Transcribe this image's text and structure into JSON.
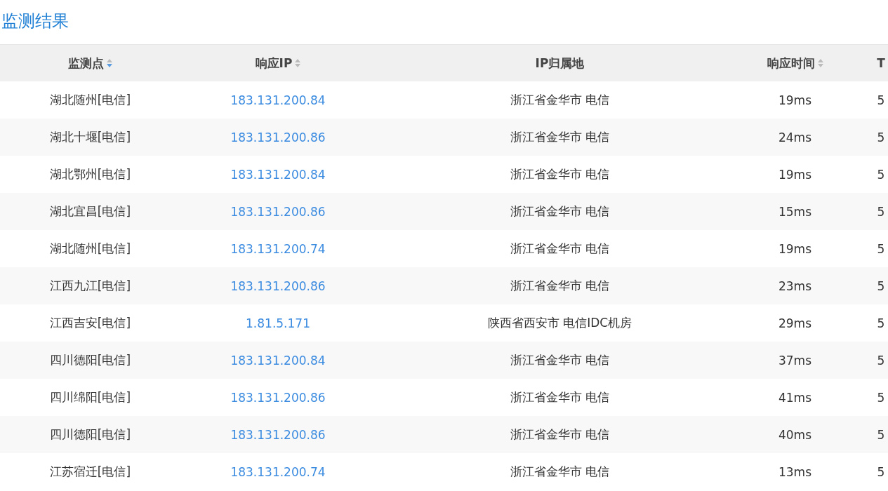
{
  "title": "监测结果",
  "table": {
    "columns": [
      {
        "kind": "sortable",
        "label": "监测点",
        "sorted": true
      },
      {
        "kind": "sortable",
        "label": "响应IP",
        "sorted": false
      },
      {
        "kind": "plain",
        "label": "IP归属地"
      },
      {
        "kind": "sortable",
        "label": "响应时间",
        "sorted": false
      },
      {
        "kind": "plain",
        "label": "T"
      }
    ],
    "rows": [
      [
        "湖北随州[电信]",
        "183.131.200.84",
        "浙江省金华市 电信",
        "19ms",
        "5"
      ],
      [
        "湖北十堰[电信]",
        "183.131.200.86",
        "浙江省金华市 电信",
        "24ms",
        "5"
      ],
      [
        "湖北鄂州[电信]",
        "183.131.200.84",
        "浙江省金华市 电信",
        "19ms",
        "5"
      ],
      [
        "湖北宜昌[电信]",
        "183.131.200.86",
        "浙江省金华市 电信",
        "15ms",
        "5"
      ],
      [
        "湖北随州[电信]",
        "183.131.200.74",
        "浙江省金华市 电信",
        "19ms",
        "5"
      ],
      [
        "江西九江[电信]",
        "183.131.200.86",
        "浙江省金华市 电信",
        "23ms",
        "5"
      ],
      [
        "江西吉安[电信]",
        "1.81.5.171",
        "陕西省西安市 电信IDC机房",
        "29ms",
        "5"
      ],
      [
        "四川德阳[电信]",
        "183.131.200.84",
        "浙江省金华市 电信",
        "37ms",
        "5"
      ],
      [
        "四川绵阳[电信]",
        "183.131.200.86",
        "浙江省金华市 电信",
        "41ms",
        "5"
      ],
      [
        "四川德阳[电信]",
        "183.131.200.86",
        "浙江省金华市 电信",
        "40ms",
        "5"
      ],
      [
        "江苏宿迁[电信]",
        "183.131.200.74",
        "浙江省金华市 电信",
        "13ms",
        "5"
      ]
    ]
  }
}
